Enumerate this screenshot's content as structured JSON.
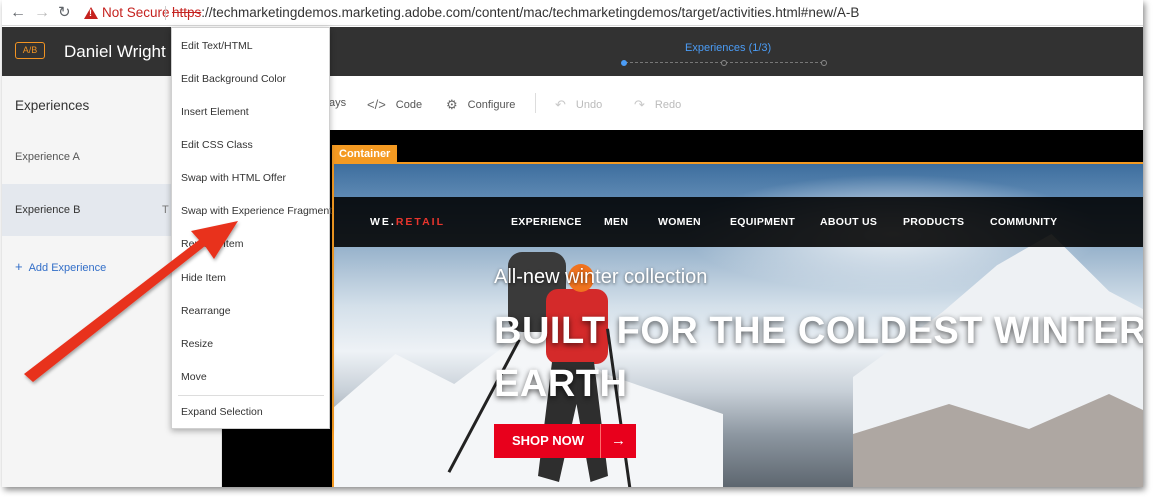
{
  "browser": {
    "back_icon": "back-arrow-icon",
    "forward_icon": "forward-arrow-icon",
    "reload_icon": "reload-icon",
    "security_label": "Not Secure",
    "url_scheme": "https",
    "url_rest": "://techmarketingdemos.marketing.adobe.com/content/mac/techmarketingdemos/target/activities.html#new/A-B"
  },
  "header": {
    "badge": "A/B",
    "activity_title": "Daniel Wright H",
    "step_label": "Experiences (1/3)",
    "steps_total": 3,
    "steps_active": 1
  },
  "left_panel": {
    "title": "Experiences",
    "experiences": [
      {
        "label": "Experience A",
        "tag": ""
      },
      {
        "label": "Experience B",
        "tag": "T"
      }
    ],
    "add_label": "Add Experience"
  },
  "toolbar": {
    "overlays_label": "ays",
    "code_label": "Code",
    "configure_label": "Configure",
    "undo_label": "Undo",
    "redo_label": "Redo"
  },
  "site": {
    "logo_main": "WE.",
    "logo_accent": "RETAIL",
    "nav": [
      "EXPERIENCE",
      "MEN",
      "WOMEN",
      "EQUIPMENT",
      "ABOUT US",
      "PRODUCTS",
      "COMMUNITY"
    ],
    "hero_subtitle": "All-new winter collection",
    "hero_title": "BUILT FOR THE COLDEST WINTER EARTH",
    "cta_label": "SHOP NOW",
    "cta_arrow": "→"
  },
  "selection": {
    "label": "Container"
  },
  "context_menu": {
    "items": [
      "Edit Text/HTML",
      "Edit Background Color",
      "Insert Element",
      "Edit CSS Class",
      "Swap with HTML Offer",
      "Swap with Experience Fragment",
      "Remove Item",
      "Hide Item",
      "Rearrange",
      "Resize",
      "Move",
      "Expand Selection"
    ]
  },
  "colors": {
    "header_bg": "#323232",
    "accent_orange": "#f49a22",
    "accent_blue": "#4b9cf5",
    "cta_red": "#e8001c",
    "annotation_red": "#e8311f"
  }
}
